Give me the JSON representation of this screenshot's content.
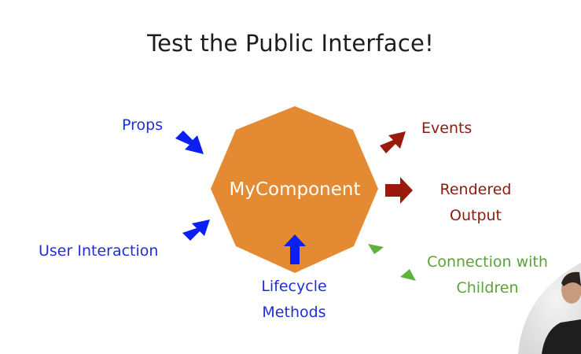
{
  "slide": {
    "title": "Test the Public Interface!",
    "center_label": "MyComponent",
    "inputs": {
      "props": "Props",
      "user_interaction": "User Interaction",
      "lifecycle_line1": "Lifecycle",
      "lifecycle_line2": "Methods"
    },
    "outputs": {
      "events": "Events",
      "rendered_line1": "Rendered",
      "rendered_line2": "Output",
      "connection_line1": "Connection with",
      "connection_line2": "Children"
    }
  },
  "colors": {
    "octagon": "#E38A33",
    "input_arrow": "#0A1FF2",
    "output_arrow": "#9A1B0C",
    "bidirectional_arrow": "#5FB33D",
    "input_text": "#1F2FD6",
    "output_text": "#8A1C0F",
    "connection_text": "#5AA23A"
  }
}
